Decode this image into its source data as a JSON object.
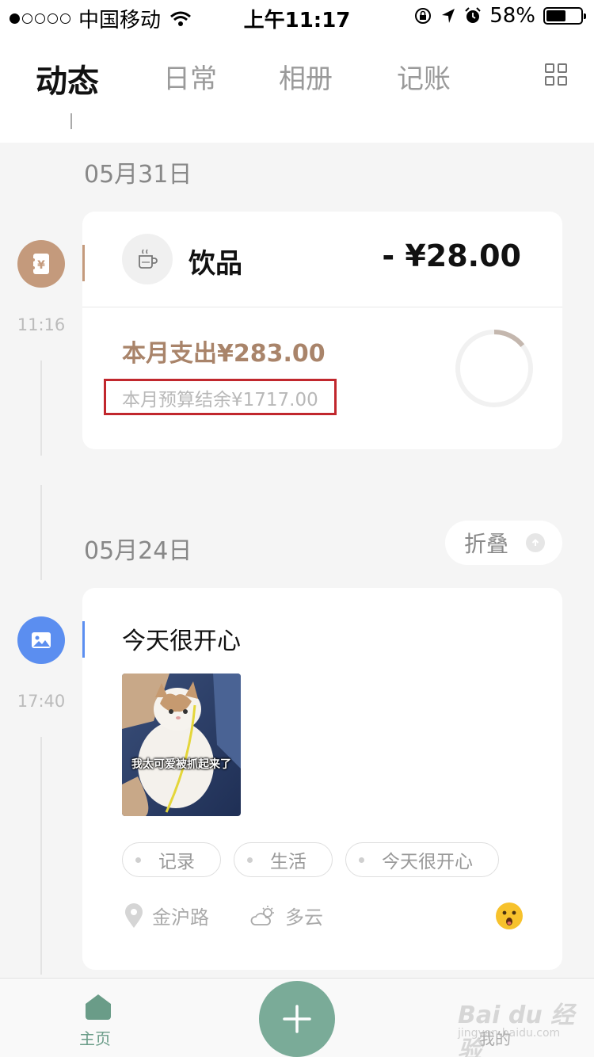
{
  "status_bar": {
    "carrier": "中国移动",
    "time": "上午11:17",
    "battery_percent": "58%",
    "battery_level": 0.58
  },
  "nav": {
    "tabs": [
      {
        "label": "动态",
        "active": true
      },
      {
        "label": "日常",
        "active": false
      },
      {
        "label": "相册",
        "active": false
      },
      {
        "label": "记账",
        "active": false
      }
    ],
    "menu_icon": "grid-icon"
  },
  "timeline": [
    {
      "date": "05月31日",
      "entry_time": "11:16",
      "icon": "yen-note-icon",
      "icon_color": "#c49a7c",
      "card": {
        "category": "饮品",
        "category_icon": "coffee-cup-icon",
        "amount": "- ¥28.00",
        "month_spend": "本月支出¥283.00",
        "budget_remaining": "本月预算结余¥1717.00",
        "spend_ratio": 0.1415
      }
    },
    {
      "date": "05月24日",
      "fold_label": "折叠",
      "entry_time": "17:40",
      "icon": "image-icon",
      "icon_color": "#5b8ef0",
      "card": {
        "title": "今天很开心",
        "photo_caption": "我太可爱被抓起来了",
        "tags": [
          "记录",
          "生活",
          "今天很开心"
        ],
        "location": "金沪路",
        "weather": "多云",
        "mood_icon": "surprised-face-icon"
      }
    }
  ],
  "bottom_bar": {
    "home_label": "主页",
    "add_icon": "plus-icon",
    "mine_label": "我的"
  },
  "watermark": {
    "brand": "Bai du 经验",
    "url": "jingyan.baidu.com"
  },
  "colors": {
    "accent_brown": "#a9846a",
    "accent_green": "#7aab98",
    "accent_blue": "#5b8ef0",
    "highlight_box": "#c1272d"
  }
}
